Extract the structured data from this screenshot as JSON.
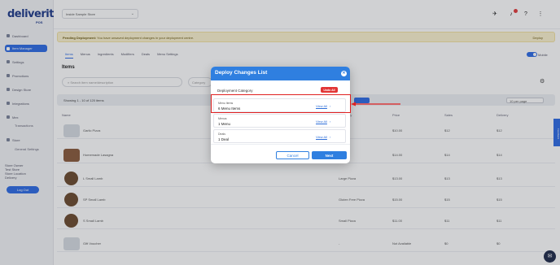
{
  "app": {
    "logo": "deliverit",
    "logo_sub": "POS"
  },
  "sidebar": {
    "items": [
      {
        "label": "Dashboard"
      },
      {
        "label": "Item Manager"
      },
      {
        "label": "Settings"
      },
      {
        "label": "Promotions"
      },
      {
        "label": "Design Store"
      },
      {
        "label": "Integrations"
      },
      {
        "label": "Mex"
      },
      {
        "label": "Store"
      }
    ],
    "subs": [
      "Transactions",
      "General Settings"
    ],
    "info": [
      "Store Owner",
      "Test Store",
      "Store Location",
      "Delivery"
    ],
    "logout": "Log Out"
  },
  "topbar": {
    "store": "Inside Sample Store",
    "notif_count": "1"
  },
  "banner": {
    "title": "Pending Deployment:",
    "text": "You have unsaved deployment changes in your deployment centre.",
    "link": "Deploy"
  },
  "tabs": [
    "Items",
    "Menus",
    "Ingredients",
    "Modifiers",
    "Deals",
    "Menu Settings"
  ],
  "toggle_label": "Mobile",
  "items_title": "Items",
  "search_placeholder": "Search item name/description",
  "category_placeholder": "Category",
  "table": {
    "showing": "Showing 1 - 10 of 120 items",
    "per_page": "10 per page",
    "columns": [
      "Name",
      "Category",
      "Price",
      "Sales",
      "Delivery"
    ],
    "rows": [
      {
        "name": "Garlic Pizza",
        "category": "Pizzas",
        "price": "$10.00",
        "sales": "$12",
        "delivery": "$12"
      },
      {
        "name": "Homemade Lasagna",
        "category": "Pasta",
        "price": "$14.00",
        "sales": "$14",
        "delivery": "$14"
      },
      {
        "name": "L Small Lamb",
        "category": "Large Pizza",
        "price": "$13.00",
        "sales": "$13",
        "delivery": "$13"
      },
      {
        "name": "SP Small Lamb",
        "category": "Gluten Free Pizza",
        "price": "$15.00",
        "sales": "$15",
        "delivery": "$15"
      },
      {
        "name": "S Small Lamb",
        "category": "Small Pizza",
        "price": "$11.00",
        "sales": "$11",
        "delivery": "$11"
      },
      {
        "name": "Gift Voucher",
        "category": "-",
        "price": "Not Available",
        "sales": "$0",
        "delivery": "$0"
      }
    ]
  },
  "modal": {
    "title": "Deploy Changes List",
    "category_label": "Deployment Category",
    "undo_all": "Undo All",
    "cards": [
      {
        "label": "Menu Items",
        "value": "6 Menu Items",
        "link": "View All"
      },
      {
        "label": "Menus",
        "value": "1 Menu",
        "link": "View All"
      },
      {
        "label": "Deals",
        "value": "1 Deal",
        "link": "View All"
      }
    ],
    "cancel": "Cancel",
    "next": "Next"
  },
  "feedback": "Feedback",
  "colors": {
    "primary": "#2f7fe0",
    "danger": "#e23434",
    "highlight": "#e02020"
  }
}
